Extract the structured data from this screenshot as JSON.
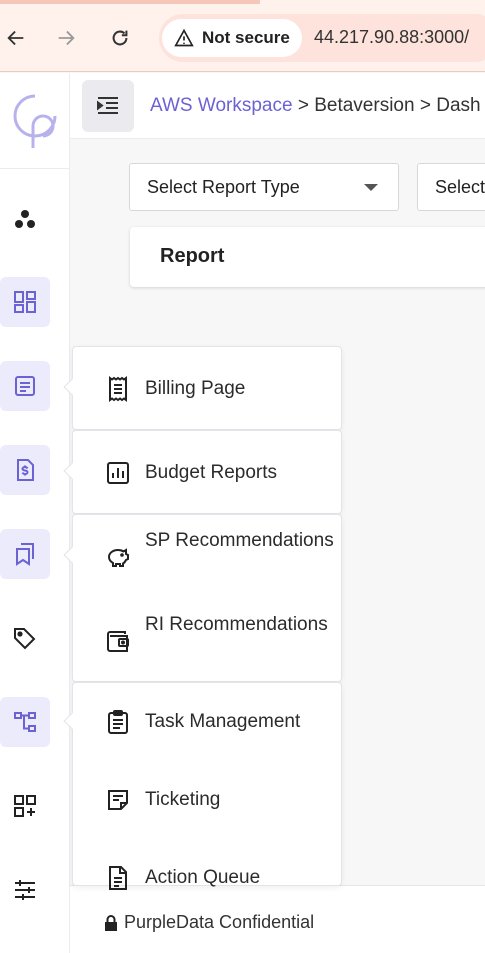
{
  "browser": {
    "security_label": "Not secure",
    "url": "44.217.90.88:3000/"
  },
  "header": {
    "breadcrumbs": [
      "AWS Workspace",
      "Betaversion",
      "Dash"
    ],
    "separator": ">"
  },
  "filters": {
    "report_type": "Select Report Type",
    "second_select": "Select"
  },
  "main": {
    "report_title": "Report"
  },
  "menus": {
    "billing": [
      {
        "label": "Billing Page",
        "icon": "receipt-icon"
      }
    ],
    "budget": [
      {
        "label": "Budget Reports",
        "icon": "bar-chart-icon"
      }
    ],
    "recommendations": [
      {
        "label": "SP Recommendations",
        "icon": "piggy-bank-icon"
      },
      {
        "label": "RI Recommendations",
        "icon": "wallet-icon"
      }
    ],
    "workflow": [
      {
        "label": "Task Management",
        "icon": "clipboard-icon"
      },
      {
        "label": "Ticketing",
        "icon": "ticket-note-icon"
      },
      {
        "label": "Action Queue",
        "icon": "document-icon"
      }
    ]
  },
  "footer": {
    "text": "PurpleData Confidential"
  },
  "colors": {
    "accent": "#6b62d4",
    "active_bg": "#ecebfc"
  }
}
